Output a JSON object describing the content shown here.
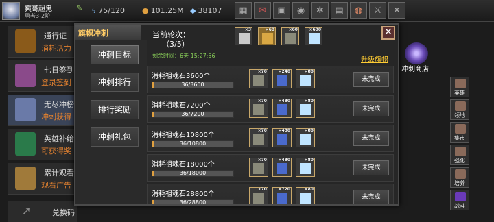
{
  "player": {
    "name": "爽哥超鬼",
    "level": "勇者3-2阶"
  },
  "stats": {
    "stamina": "75/120",
    "gold": "101.25M",
    "gems": "38107"
  },
  "top_icons": [
    "shop-icon",
    "mail-icon",
    "gamepad-icon",
    "eye-icon",
    "gear-icon",
    "gift-icon",
    "swirl-icon",
    "sword-icon",
    "tools-icon"
  ],
  "bg_list": [
    {
      "title": "通行证",
      "subtitle": "消耗活力"
    },
    {
      "title": "七日签到",
      "subtitle": "登录签到"
    },
    {
      "title": "无尽冲榜",
      "subtitle": "冲刺获得"
    },
    {
      "title": "英雄补给",
      "subtitle": "可获得奖"
    },
    {
      "title": "累计观看",
      "subtitle": "观看广告"
    }
  ],
  "redeem_label": "兑换码",
  "right_side": {
    "shop_label": "冲刺商店",
    "nav": [
      "英雄",
      "领地",
      "集市",
      "强化",
      "培养",
      "战斗"
    ]
  },
  "modal": {
    "title": "旗帜冲刺",
    "tabs": [
      "冲刺目标",
      "冲刺排行",
      "排行奖励",
      "冲刺礼包"
    ],
    "round_label": "当前轮次：",
    "round_value": "（3/5）",
    "remaining": "剩余时间：6天 15:27:56",
    "upgrade_link": "升级旗帜",
    "close_label": "✕",
    "top_rewards": [
      {
        "icon": "scroll-icon",
        "count": "×3"
      },
      {
        "icon": "flag-icon",
        "count": "×60"
      },
      {
        "icon": "hammer-icon",
        "count": "×60"
      },
      {
        "icon": "diamond-icon",
        "count": "×600"
      }
    ],
    "tasks": [
      {
        "name": "消耗祖魂石3600个",
        "progress": "36/3600",
        "fraction": 0.01,
        "rewards": [
          "×70",
          "×240",
          "×80"
        ],
        "status": "未完成"
      },
      {
        "name": "消耗祖魂石7200个",
        "progress": "36/7200",
        "fraction": 0.005,
        "rewards": [
          "×70",
          "×480",
          "×80"
        ],
        "status": "未完成"
      },
      {
        "name": "消耗祖魂石10800个",
        "progress": "36/10800",
        "fraction": 0.0033,
        "rewards": [
          "×70",
          "×480",
          "×80"
        ],
        "status": "未完成"
      },
      {
        "name": "消耗祖魂石18000个",
        "progress": "36/18000",
        "fraction": 0.002,
        "rewards": [
          "×70",
          "×480",
          "×80"
        ],
        "status": "未完成"
      },
      {
        "name": "消耗祖魂石28800个",
        "progress": "36/28800",
        "fraction": 0.00125,
        "rewards": [
          "×70",
          "×720",
          "×80"
        ],
        "status": "未完成"
      }
    ]
  },
  "colors": {
    "accent_gold": "#ffcc33",
    "progress_fill": "#e0a040",
    "timer_green": "#8bd15a"
  }
}
